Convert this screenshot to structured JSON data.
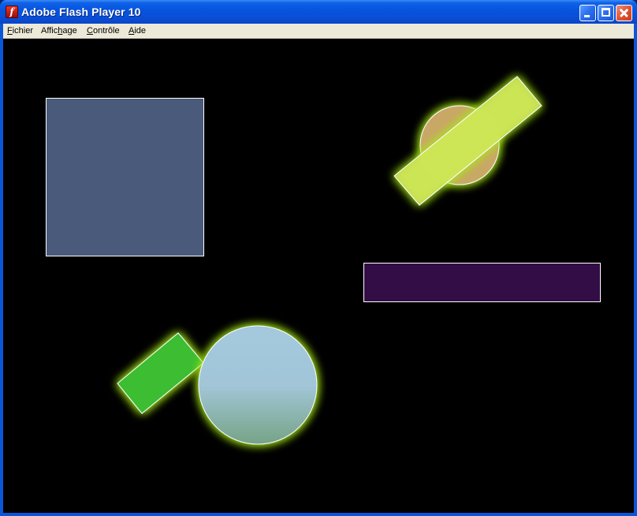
{
  "window": {
    "title": "Adobe Flash Player 10",
    "app_icon": "flash-player-icon",
    "app_icon_glyph": "f",
    "controls": {
      "minimize": "minimize-icon",
      "maximize": "maximize-icon",
      "close": "close-icon"
    }
  },
  "menu": {
    "items": [
      {
        "label": "Fichier",
        "accel_char": "F",
        "rest": "ichier"
      },
      {
        "label": "Affichage",
        "prefix": "Affic",
        "accel_char": "h",
        "rest": "age"
      },
      {
        "label": "Contrôle",
        "accel_char": "C",
        "rest": "ontrôle"
      },
      {
        "label": "Aide",
        "accel_char": "A",
        "rest": "ide"
      }
    ]
  },
  "stage": {
    "background": "#000000",
    "shapes": [
      {
        "name": "slate-square",
        "kind": "rectangle",
        "fill": "#4a5a7a"
      },
      {
        "name": "yellow-green-bar",
        "kind": "rotated-rectangle",
        "fill": "#d2e65a",
        "glow": "#a6e81c"
      },
      {
        "name": "orange-circle",
        "kind": "circle",
        "fill": "#c9a866",
        "glow": "#a6e81c"
      },
      {
        "name": "purple-bar",
        "kind": "rectangle",
        "fill": "#330d45"
      },
      {
        "name": "green-bar",
        "kind": "rotated-rectangle",
        "fill": "#3cbd31",
        "glow": "#8ee81c"
      },
      {
        "name": "light-blue-circle",
        "kind": "circle",
        "fill": "#a4c8dd",
        "fill_bottom": "#7aa68a",
        "glow": "#a6e81c"
      }
    ]
  }
}
